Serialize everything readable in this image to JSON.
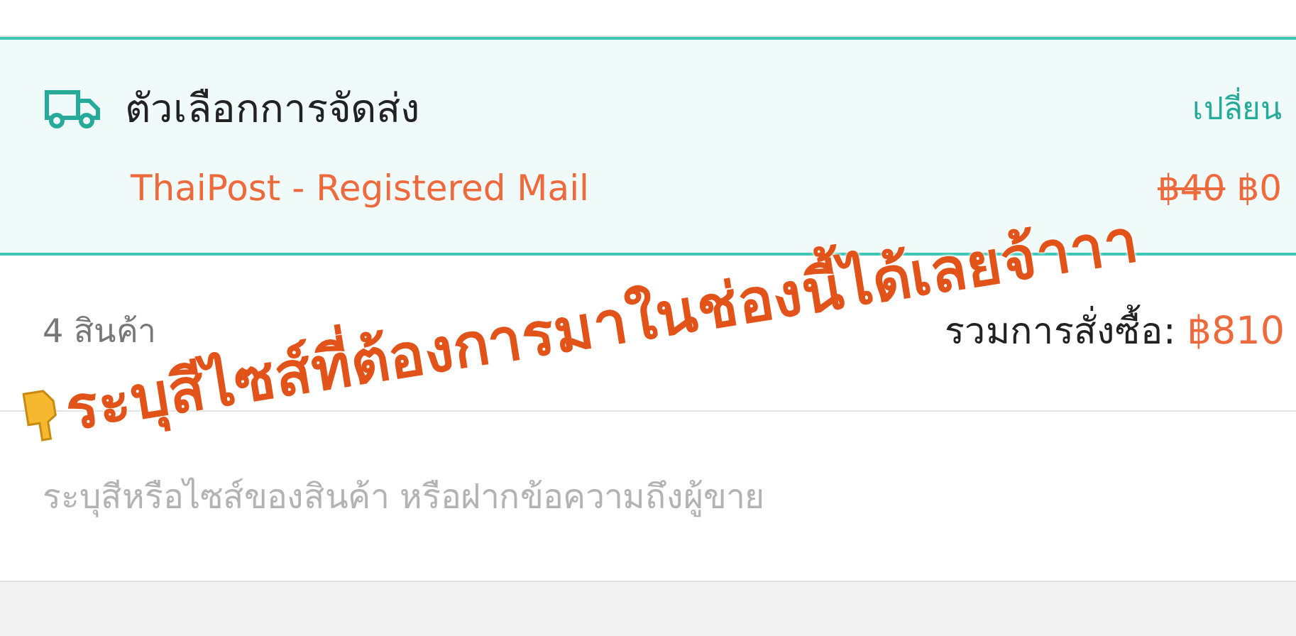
{
  "shipping": {
    "title": "ตัวเลือกการจัดส่ง",
    "action": "เปลี่ยน",
    "method": "ThaiPost - Registered Mail",
    "old_price": "฿40",
    "price": "฿0"
  },
  "summary": {
    "count": "4 สินค้า",
    "total_label": "รวมการสั่งซื้อ:",
    "total": "฿810"
  },
  "note": {
    "placeholder": "ระบุสีหรือไซส์ของสินค้า หรือฝากข้อความถึงผู้ขาย"
  },
  "annotation": {
    "text": "ระบุสีไซส์ที่ต้องการมาในช่องนี้ได้เลยจ้าาา"
  }
}
